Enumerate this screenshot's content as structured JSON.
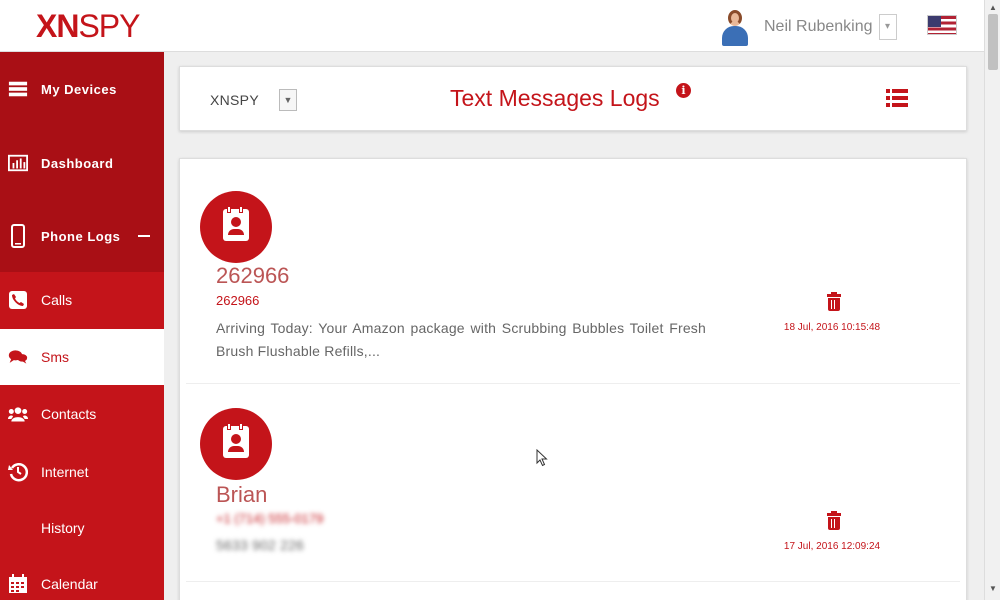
{
  "header": {
    "logo": {
      "x": "X",
      "n": "N",
      "spy": "SPY"
    },
    "user_name": "Neil Rubenking",
    "colors": {
      "brand": "#c4141a"
    }
  },
  "sidebar": {
    "items": [
      {
        "label": "My Devices",
        "icon": "devices-icon"
      },
      {
        "label": "Dashboard",
        "icon": "dashboard-icon"
      },
      {
        "label": "Phone Logs",
        "icon": "phone-icon"
      },
      {
        "label": "Calls",
        "icon": "call-icon"
      },
      {
        "label": "Sms",
        "icon": "chat-icon"
      },
      {
        "label": "Contacts",
        "icon": "contacts-icon"
      },
      {
        "label": "Internet",
        "icon": "history-icon"
      },
      {
        "label": "History",
        "icon": ""
      },
      {
        "label": "Calendar",
        "icon": "calendar-icon"
      }
    ]
  },
  "toolbar": {
    "device": "XNSPY",
    "title": "Text Messages Logs"
  },
  "messages": [
    {
      "name": "262966",
      "number": "262966",
      "text": "Arriving Today: Your Amazon package with Scrubbing Bubbles Toilet Fresh Brush Flushable Refills,...",
      "date": "18 Jul, 2016 10:15:48"
    },
    {
      "name": "Brian",
      "number": "+1 (714) 555-0179",
      "text": "5633 902 226",
      "date": "17 Jul, 2016 12:09:24"
    }
  ]
}
